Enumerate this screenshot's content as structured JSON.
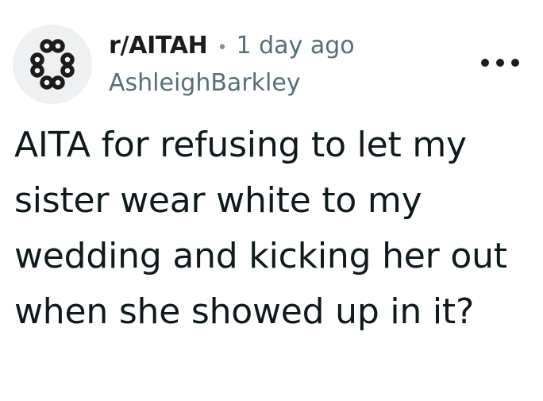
{
  "post": {
    "subreddit": "r/AITAH",
    "separator": "•",
    "time_ago": "1 day ago",
    "author": "AshleighBarkley",
    "title": "AITA for refusing to let my sister wear white to my wedding and kicking her out when she showed up in it?"
  },
  "icons": {
    "avatar": "subreddit-default-icon",
    "more": "overflow-menu-icon"
  },
  "colors": {
    "avatar_bg": "#eef0f1",
    "meta_text": "#576f76",
    "title_text": "#0f1a1c"
  }
}
